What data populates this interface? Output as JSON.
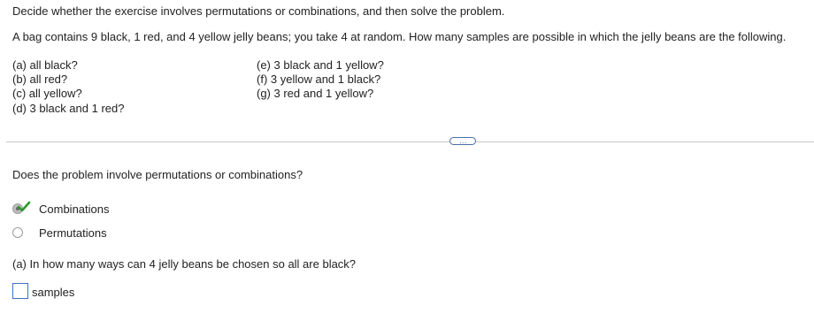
{
  "instructions": "Decide whether the exercise involves permutations or combinations, and then solve the problem.",
  "problem": "A bag contains 9 black, 1 red, and 4 yellow jelly beans; you take 4 at random. How many  samples are possible in which the jelly beans are the following.",
  "parts_left": [
    "(a) all black?",
    "(b) all red?",
    "(c) all yellow?",
    "(d) 3 black and 1 red?"
  ],
  "parts_right": [
    "(e) 3 black and 1 yellow?",
    "(f) 3 yellow and 1 black?",
    "(g) 3 red and 1 yellow?"
  ],
  "expand_label": "…",
  "question1": "Does the problem involve permutations or combinations?",
  "options": {
    "combinations": "Combinations",
    "permutations": "Permutations",
    "selected": "Combinations"
  },
  "question_a": "(a) In how many ways can 4 jelly beans be chosen so all are black?",
  "answer_a": {
    "value": "",
    "unit": "samples"
  },
  "colors": {
    "check": "#2e9a2e",
    "input_border": "#3b74c4",
    "divider": "#c8c8c8"
  }
}
